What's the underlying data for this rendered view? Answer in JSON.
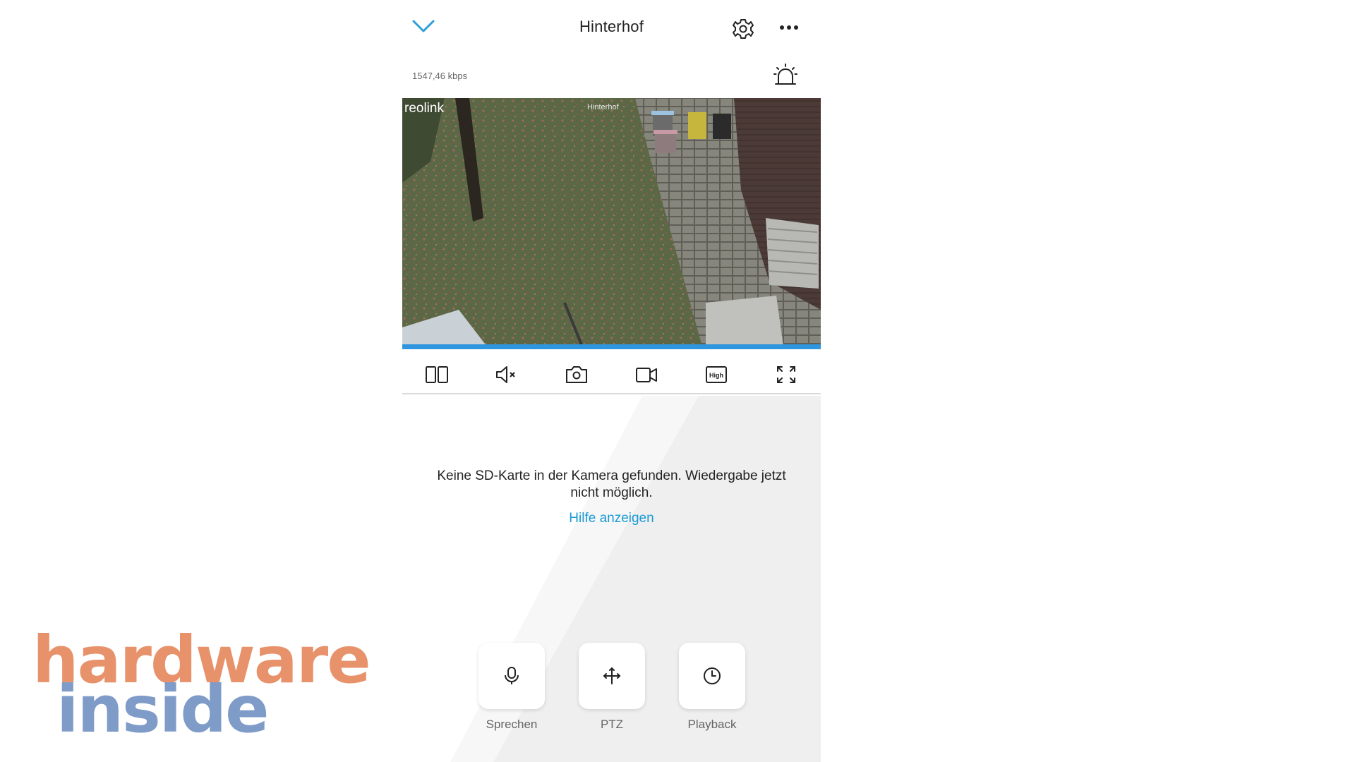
{
  "header": {
    "title": "Hinterhof"
  },
  "stream": {
    "bitrate": "1547,46 kbps",
    "overlay_brand": "reolink",
    "overlay_name": "Hinterhof",
    "progress_percent": 100
  },
  "toolbar": {
    "items": [
      {
        "icon": "split-view-icon"
      },
      {
        "icon": "mute-icon"
      },
      {
        "icon": "camera-snapshot-icon"
      },
      {
        "icon": "video-record-icon"
      },
      {
        "icon": "quality-high-icon",
        "label": "High"
      },
      {
        "icon": "fullscreen-icon"
      }
    ]
  },
  "notice": {
    "message": "Keine SD-Karte in der Kamera gefunden. Wiedergabe jetzt nicht möglich.",
    "help_link": "Hilfe anzeigen"
  },
  "actions": [
    {
      "label": "Sprechen",
      "icon": "microphone-icon"
    },
    {
      "label": "PTZ",
      "icon": "ptz-icon"
    },
    {
      "label": "Playback",
      "icon": "clock-icon"
    }
  ],
  "watermark": {
    "line1": "hardware",
    "line2": "inside"
  },
  "colors": {
    "accent": "#1a9ad6",
    "progress": "#2f95df",
    "watermark_orange": "#e8926b",
    "watermark_blue": "#7f9bc8"
  }
}
